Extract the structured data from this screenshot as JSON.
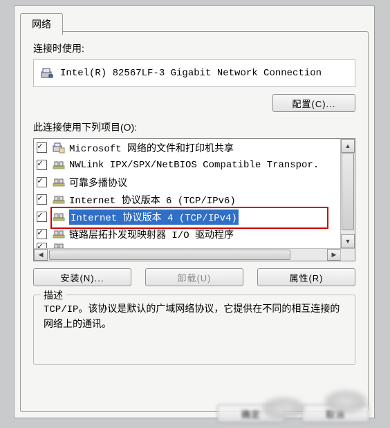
{
  "tab": {
    "label": "网络"
  },
  "connectUsing": {
    "label": "连接时使用:",
    "adapter": "Intel(R) 82567LF-3 Gigabit Network Connection"
  },
  "buttons": {
    "configure": "配置(C)...",
    "install": "安装(N)...",
    "uninstall": "卸载(U)",
    "properties": "属性(R)",
    "ok": "确定",
    "cancel": "取消"
  },
  "itemsLabel": "此连接使用下列项目(O):",
  "items": [
    {
      "label": "Microsoft 网络的文件和打印机共享",
      "checked": true,
      "icon": "service",
      "selected": false
    },
    {
      "label": "NWLink IPX/SPX/NetBIOS Compatible Transpor.",
      "checked": true,
      "icon": "protocol",
      "selected": false
    },
    {
      "label": "可靠多播协议",
      "checked": true,
      "icon": "protocol",
      "selected": false
    },
    {
      "label": "Internet 协议版本 6 (TCP/IPv6)",
      "checked": true,
      "icon": "protocol",
      "selected": false
    },
    {
      "label": "Internet 协议版本 4 (TCP/IPv4)",
      "checked": true,
      "icon": "protocol",
      "selected": true
    },
    {
      "label": "链路层拓扑发现映射器 I/O 驱动程序",
      "checked": true,
      "icon": "protocol",
      "selected": false
    }
  ],
  "description": {
    "title": "描述",
    "text": "TCP/IP。该协议是默认的广域网络协议，它提供在不同的相互连接的网络上的通讯。"
  }
}
